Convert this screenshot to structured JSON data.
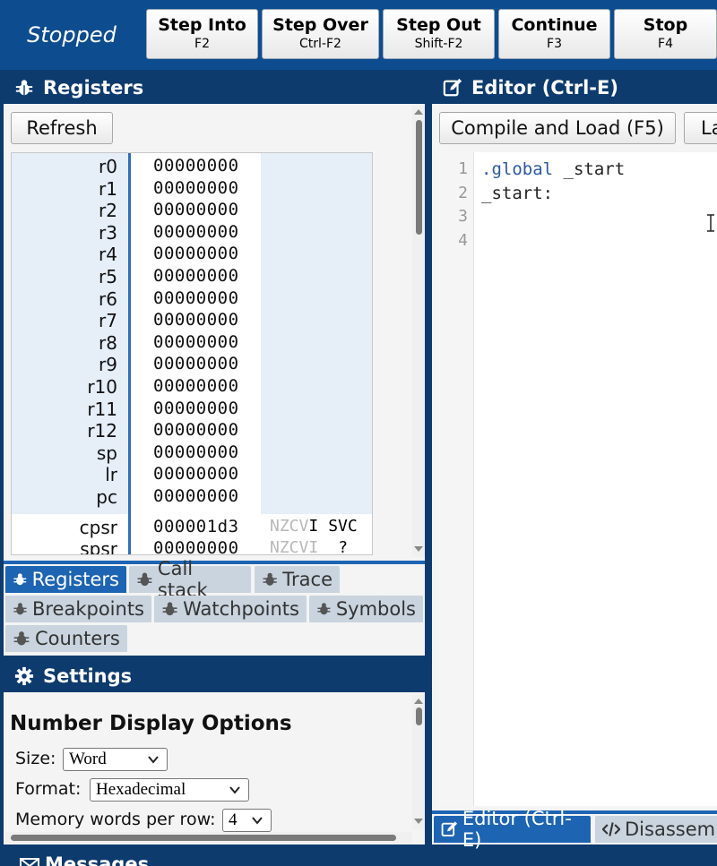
{
  "toolbar": {
    "status": "Stopped",
    "buttons": [
      {
        "label": "Step Into",
        "key": "F2"
      },
      {
        "label": "Step Over",
        "key": "Ctrl-F2"
      },
      {
        "label": "Step Out",
        "key": "Shift-F2"
      },
      {
        "label": "Continue",
        "key": "F3"
      },
      {
        "label": "Stop",
        "key": "F4"
      }
    ]
  },
  "registers_panel": {
    "title": "Registers",
    "icon": "bug-icon",
    "refresh_label": "Refresh",
    "registers": [
      {
        "name": "r0",
        "value": "00000000"
      },
      {
        "name": "r1",
        "value": "00000000"
      },
      {
        "name": "r2",
        "value": "00000000"
      },
      {
        "name": "r3",
        "value": "00000000"
      },
      {
        "name": "r4",
        "value": "00000000"
      },
      {
        "name": "r5",
        "value": "00000000"
      },
      {
        "name": "r6",
        "value": "00000000"
      },
      {
        "name": "r7",
        "value": "00000000"
      },
      {
        "name": "r8",
        "value": "00000000"
      },
      {
        "name": "r9",
        "value": "00000000"
      },
      {
        "name": "r10",
        "value": "00000000"
      },
      {
        "name": "r11",
        "value": "00000000"
      },
      {
        "name": "r12",
        "value": "00000000"
      },
      {
        "name": "sp",
        "value": "00000000"
      },
      {
        "name": "lr",
        "value": "00000000"
      },
      {
        "name": "pc",
        "value": "00000000"
      }
    ],
    "status_registers": [
      {
        "name": "cpsr",
        "value": "000001d3",
        "flags_dim": "NZCV",
        "flags_on": "I",
        "mode": "SVC"
      },
      {
        "name": "spsr",
        "value": "00000000",
        "flags_dim": "NZCVI",
        "flags_on": "",
        "mode": "?"
      }
    ],
    "tabs": [
      {
        "label": "Registers",
        "active": true
      },
      {
        "label": "Call stack",
        "active": false
      },
      {
        "label": "Trace",
        "active": false
      },
      {
        "label": "Breakpoints",
        "active": false
      },
      {
        "label": "Watchpoints",
        "active": false
      },
      {
        "label": "Symbols",
        "active": false
      },
      {
        "label": "Counters",
        "active": false
      }
    ]
  },
  "settings_panel": {
    "title": "Settings",
    "icon": "gear-icon",
    "heading": "Number Display Options",
    "size_label": "Size:",
    "size_value": "Word",
    "format_label": "Format:",
    "format_value": "Hexadecimal",
    "words_label": "Memory words per row:",
    "words_value": "4"
  },
  "editor_panel": {
    "title": "Editor (Ctrl-E)",
    "icon": "edit-icon",
    "compile_label": "Compile and Load (F5)",
    "second_button_partial": "La",
    "lines": [
      {
        "num": "1",
        "directive": ".global",
        "rest": " _start"
      },
      {
        "num": "2",
        "directive": "",
        "rest": "_start:"
      },
      {
        "num": "3",
        "directive": "",
        "rest": ""
      },
      {
        "num": "4",
        "directive": "",
        "rest": ""
      }
    ],
    "tabs": [
      {
        "label": "Editor (Ctrl-E)",
        "active": true
      },
      {
        "label": "Disassem",
        "active": false
      }
    ]
  },
  "messages_panel": {
    "title": "Messages"
  },
  "colors": {
    "header_bg": "#0d3b6e",
    "toolbar_bg": "#0d4d8f",
    "tab_active": "#1d65b3",
    "register_highlight": "#e6eef8"
  }
}
